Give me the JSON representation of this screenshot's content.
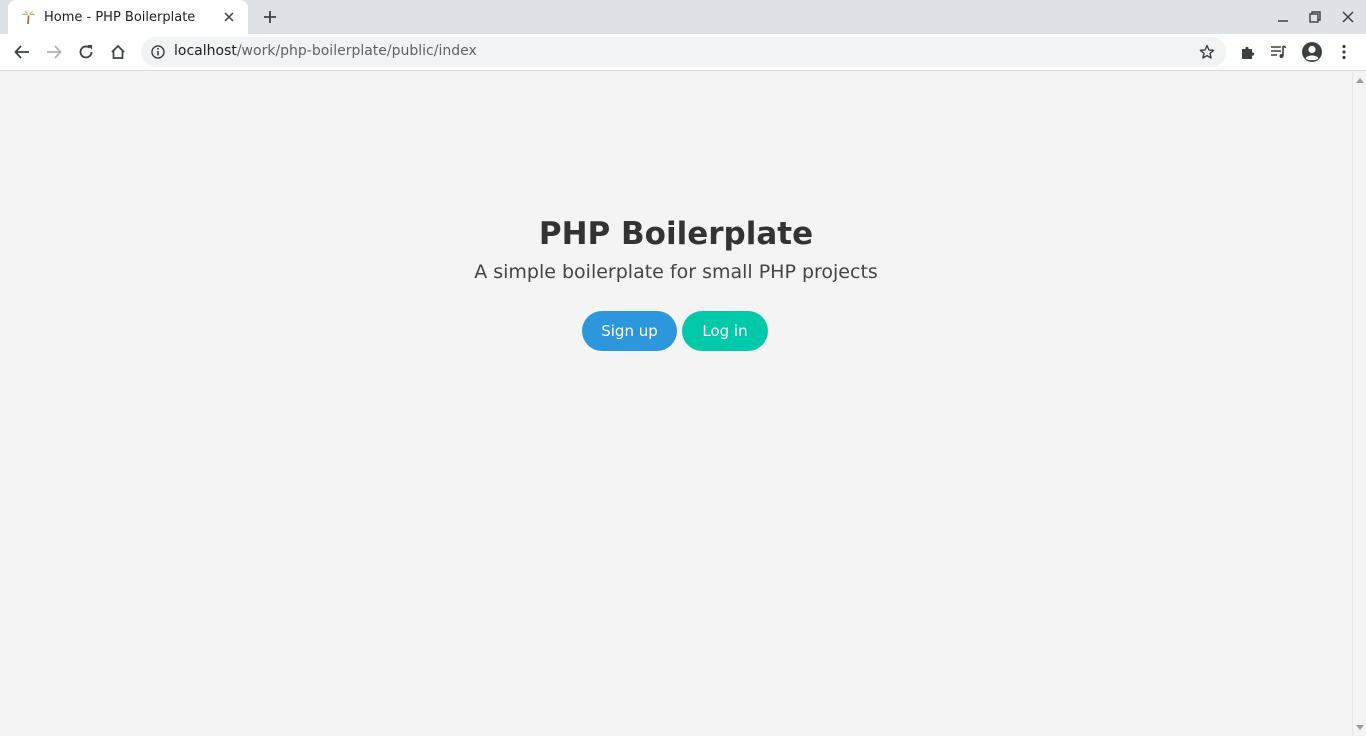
{
  "browser": {
    "tab": {
      "title": "Home - PHP Boilerplate",
      "favicon": "palm-tree-icon"
    },
    "url": {
      "host": "localhost",
      "path": "/work/php-boilerplate/public/index"
    },
    "icons": {
      "back": "back-arrow-icon",
      "forward": "forward-arrow-icon",
      "reload": "reload-icon",
      "home": "home-icon",
      "site_info": "info-icon",
      "bookmark": "star-icon",
      "extensions": "puzzle-icon",
      "media": "media-queue-icon",
      "profile": "avatar-icon",
      "menu": "kebab-menu-icon"
    }
  },
  "page": {
    "title": "PHP Boilerplate",
    "subtitle": "A simple boilerplate for small PHP projects",
    "buttons": {
      "signup": "Sign up",
      "login": "Log in"
    }
  },
  "colors": {
    "signup": "#2c97dd",
    "login": "#00c9aa",
    "page_bg": "#f4f4f4",
    "heading": "#333333"
  }
}
